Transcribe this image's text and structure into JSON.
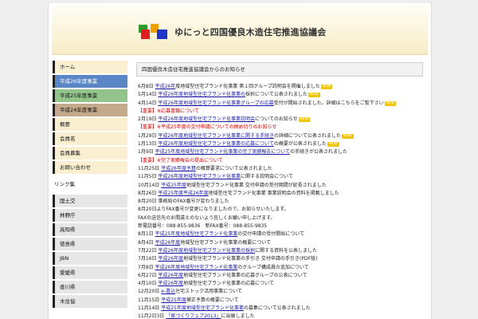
{
  "site": {
    "title": "ゆにっと四国優良木造住宅推進協議会",
    "logo_colors": [
      "#e02020",
      "#2b9a2b",
      "#f0a000",
      "#1f35c8"
    ]
  },
  "nav": {
    "items": [
      {
        "label": "ホーム",
        "style": "y"
      },
      {
        "label": "平成26年度事業",
        "style": "blue"
      },
      {
        "label": "平成25年度事業",
        "style": "green"
      },
      {
        "label": "平成24年度事業",
        "style": "tan"
      },
      {
        "label": "概要",
        "style": "y"
      },
      {
        "label": "会員名",
        "style": "y"
      },
      {
        "label": "会員募集",
        "style": "y"
      },
      {
        "label": "お問い合わせ",
        "style": "y"
      }
    ],
    "section_label": "リンク集",
    "links": [
      "国土交",
      "林野庁",
      "高知県",
      "徳島県",
      "JBN",
      "愛媛県",
      "香川県",
      "木住協"
    ]
  },
  "main": {
    "heading": "四国優良木造住宅推進協議会からのお知らせ",
    "news": [
      {
        "date": "6月8日",
        "link": "平成26年",
        "text": "度地域型住宅ブランド化事業 第１回グループ説明会を開催しました",
        "new": true,
        "red": false
      },
      {
        "date": "5月14日",
        "link": "平成26年度地域型住宅ブランド化事業の",
        "text": "採択について公表されました",
        "new": true,
        "red": false
      },
      {
        "date": "4月14日",
        "link": "平成26年度地域型住宅ブランド化事業グループの応募",
        "text": "受付が開始されました。詳細はこちらをご覧下さい",
        "new": true,
        "red": false
      },
      {
        "date": "",
        "link": "",
        "text": "【重要】※応募書類について",
        "new": false,
        "red": true
      },
      {
        "date": "2月19日",
        "link": "平成26年度地域型住宅ブランド化事業説明会",
        "text": "についてのお知らせ",
        "new": true,
        "red": false
      },
      {
        "date": "",
        "link": "",
        "text": "【重要】※平成25年度の交付申請についての締め切りのお知らせ",
        "new": false,
        "red": true
      },
      {
        "date": "1月29日",
        "link": "平成26年度地域型住宅ブランド化事業に関する手続き",
        "text": "の詳細について公表されました",
        "new": true,
        "red": false
      },
      {
        "date": "1月13日",
        "link": "平成26年度地域型住宅ブランド化事業の応募について",
        "text": "の概要が公表されました",
        "new": true,
        "red": false
      },
      {
        "date": "1月9日",
        "link": "平成25年度地域型住宅ブランド化事業の完了実績報告について",
        "text": "の手続きが公表されました",
        "new": false,
        "red": false
      },
      {
        "date": "",
        "link": "",
        "text": "【重要】※完了実績報告の提出について",
        "new": false,
        "red": true
      },
      {
        "date": "11月25日",
        "link": "平成26年度予算",
        "text": "の概算要求について公表されました",
        "new": false,
        "red": false
      },
      {
        "date": "11月5日",
        "link": "平成26年度地域型住宅ブランド化事業",
        "text": "に関する説明会について",
        "new": false,
        "red": false
      },
      {
        "date": "10月14日",
        "link": "平成25年度",
        "text": "地域型住宅ブランド化事業 交付申請の受付期間が延長されました",
        "new": false,
        "red": false
      },
      {
        "date": "8月26日",
        "link": "平成25年度平成26年度",
        "text": "地域型住宅ブランド化事業 事業説明会の資料を掲載しました",
        "new": false,
        "red": false
      },
      {
        "date": "8月20日",
        "link": "",
        "text": "事務局のFAX番号が変わりました",
        "new": false,
        "red": false
      },
      {
        "date": "",
        "link": "",
        "text": "8月20日よりFAX番号が変更になりましたので、お知らせいたします。",
        "new": false,
        "red": false
      },
      {
        "date": "",
        "link": "",
        "text": "FAXの送信先のお間違えのないよう宜しくお願い申し上げます。",
        "new": false,
        "red": false
      },
      {
        "date": "",
        "link": "",
        "text": "新電話番号：088-855-9836　新FAX番号：088-855-9835",
        "new": false,
        "red": false
      },
      {
        "date": "8月1日",
        "link": "平成25年度地域型住宅ブランド化事業",
        "text": "の交付申請の受付開始について",
        "new": false,
        "red": false
      },
      {
        "date": "8月4日",
        "link": "平成26年度",
        "text": "地域型住宅ブランド化事業の概要について",
        "new": false,
        "red": false
      },
      {
        "date": "7月22日",
        "link": "平成26年度地域型住宅ブランド化事業の採択",
        "text": "に関する資料を公表しました",
        "new": false,
        "red": false
      },
      {
        "date": "7月16日",
        "link": "平成26年度",
        "text": "地域型住宅ブランド化事業の手引き 交付申請の手引き(PDF版)",
        "new": false,
        "red": false
      },
      {
        "date": "7月8日",
        "link": "平成26年度地域型住宅ブランド化事業",
        "text": "のグループ構成員の追加について",
        "new": false,
        "red": false
      },
      {
        "date": "6月27日",
        "link": "平成26年度",
        "text": "地域型住宅ブランド化事業の応募グループの公表について",
        "new": false,
        "red": false
      },
      {
        "date": "4月10日",
        "link": "平成26年度",
        "text": "地域型住宅ブランド化事業の応募について",
        "new": false,
        "red": false
      },
      {
        "date": "12月20日",
        "link": "e-書込",
        "text": "住宅ストック活用事業について",
        "new": false,
        "red": false
      },
      {
        "date": "11月15日",
        "link": "平成25年度",
        "text": "補正予算の概要について",
        "new": false,
        "red": false
      },
      {
        "date": "11月14日",
        "link": "平成25年度地域型住宅ブランド化事業",
        "text": "の募集について公表されました",
        "new": false,
        "red": false
      },
      {
        "date": "11月2日3日",
        "link": "「家づくりフェア2013」",
        "text": "に出展しました",
        "new": false,
        "red": false
      }
    ]
  }
}
